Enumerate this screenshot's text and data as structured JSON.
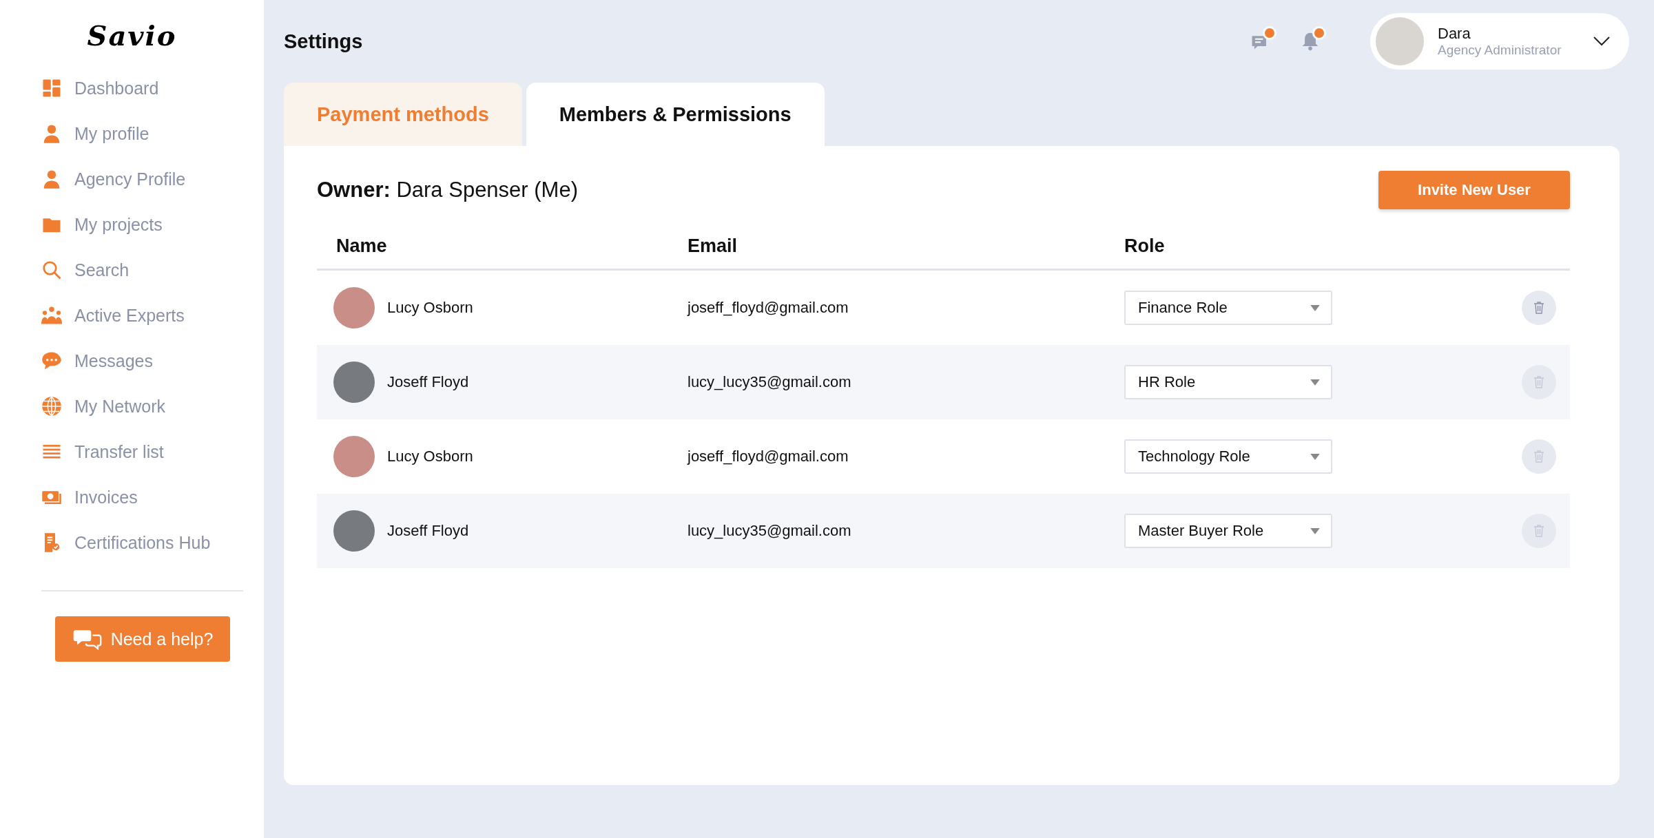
{
  "sidebar": {
    "logo": "Savio",
    "items": [
      {
        "label": "Dashboard",
        "selected": false
      },
      {
        "label": "My profile",
        "selected": false
      },
      {
        "label": "Agency Profile",
        "selected": false
      },
      {
        "label": "My projects",
        "selected": false
      },
      {
        "label": "Search",
        "selected": false
      },
      {
        "label": "Active Experts",
        "selected": false
      },
      {
        "label": "Messages",
        "selected": false
      },
      {
        "label": "My Network",
        "selected": false
      },
      {
        "label": "Transfer list",
        "selected": false
      },
      {
        "label": "Invoices",
        "selected": false
      },
      {
        "label": "Certifications Hub",
        "selected": false
      }
    ],
    "help_button": "Need a help?"
  },
  "header": {
    "title": "Settings",
    "messages_unread": true,
    "notifications_unread": true,
    "user": {
      "name": "Dara",
      "role": "Agency Administrator"
    }
  },
  "tabs": [
    {
      "label": "Payment methods",
      "selected": false
    },
    {
      "label": "Members & Permissions",
      "selected": true
    }
  ],
  "owner": "**Owner:** Dara Spenser (Me)",
  "invite_button": "Invite New User",
  "table": {
    "columns": [
      "Name",
      "Email",
      "Role"
    ],
    "rows": [
      {
        "name": "Lucy Osborn",
        "email": "joseff_floyd@gmail.com",
        "role": "Finance Role",
        "delete_disabled": false
      },
      {
        "name": "Joseff Floyd",
        "email": "lucy_lucy35@gmail.com",
        "role": "HR Role",
        "delete_disabled": true
      },
      {
        "name": "Lucy Osborn",
        "email": "joseff_floyd@gmail.com",
        "role": "Technology Role",
        "delete_disabled": true
      },
      {
        "name": "Joseff Floyd",
        "email": "lucy_lucy35@gmail.com",
        "role": "Master Buyer Role",
        "delete_disabled": true
      }
    ]
  }
}
